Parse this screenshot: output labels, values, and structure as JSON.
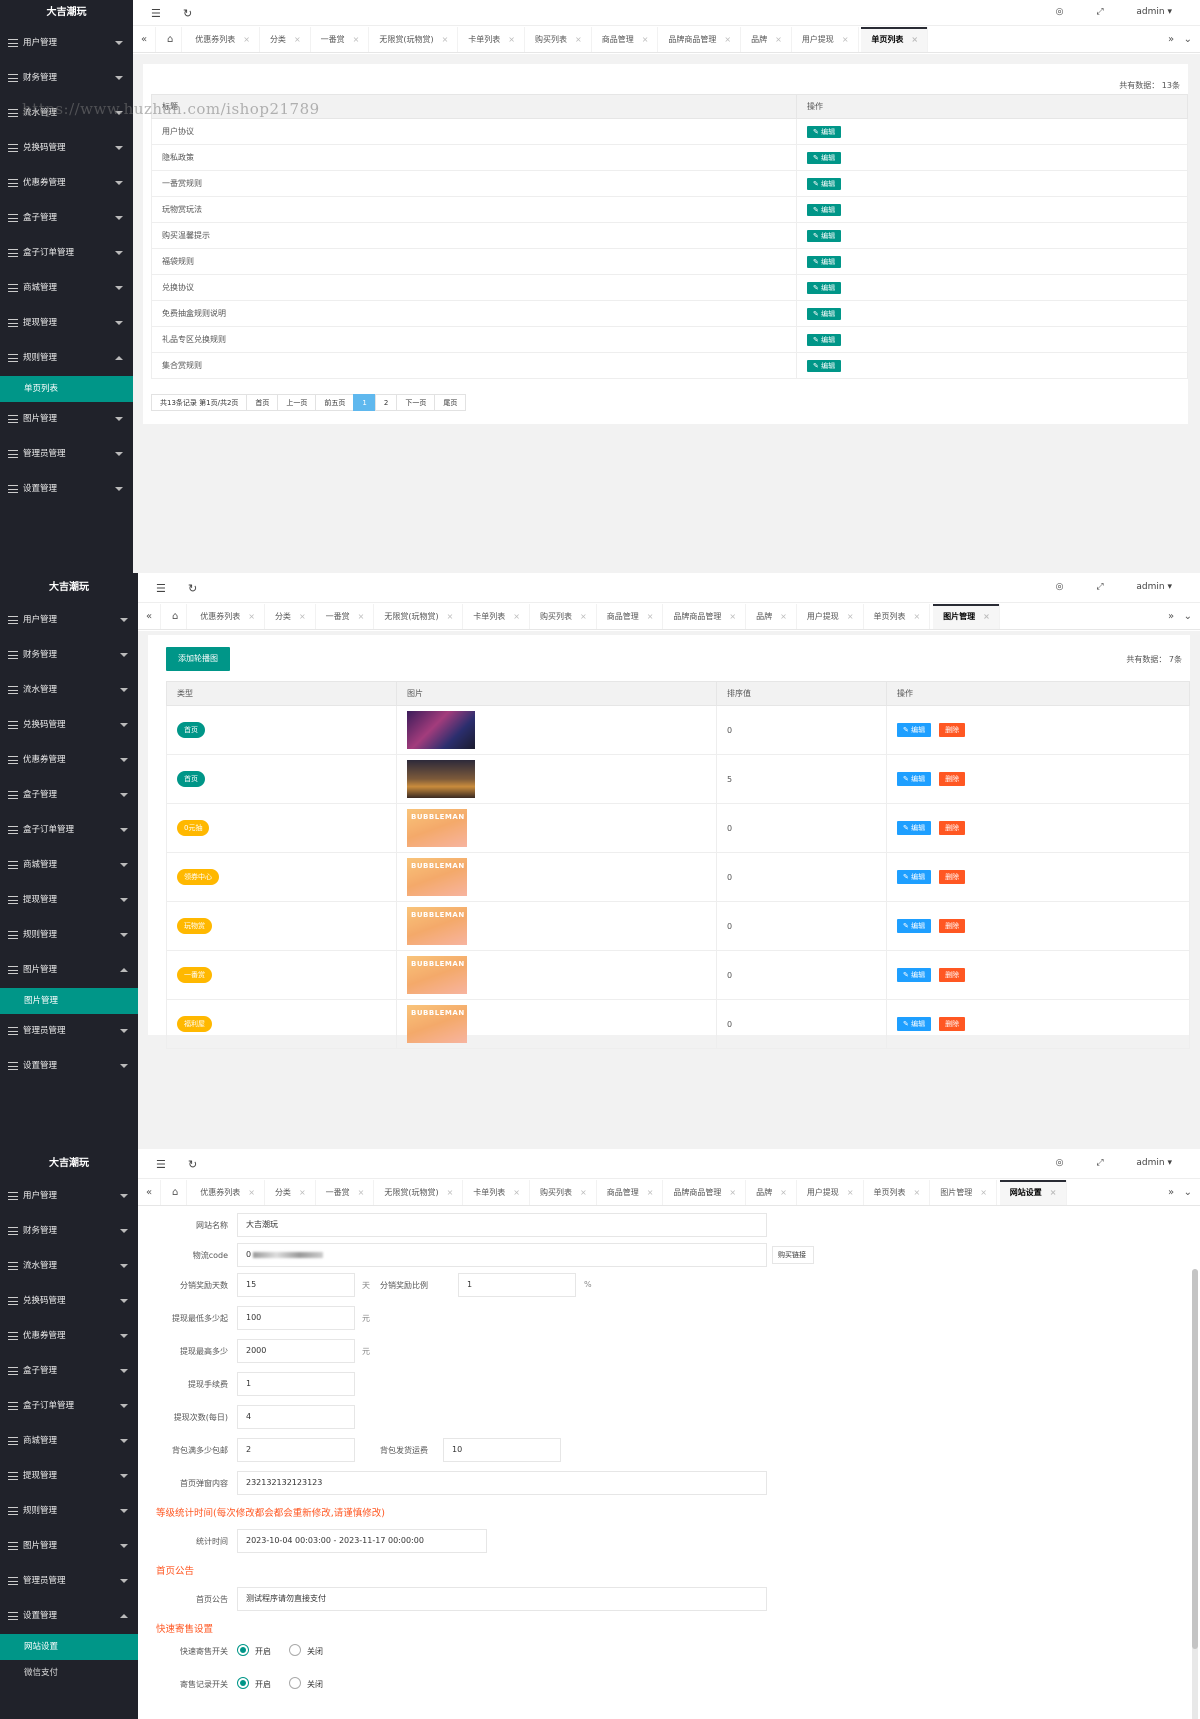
{
  "app": {
    "title": "大吉潮玩",
    "user": "admin"
  },
  "watermark": "https://www.huzhan.com/ishop21789",
  "panel1": {
    "menu": [
      "用户管理",
      "财务管理",
      "流水管理",
      "兑换码管理",
      "优惠券管理",
      "盒子管理",
      "盒子订单管理",
      "商城管理",
      "提现管理",
      "规则管理",
      "图片管理",
      "管理员管理",
      "设置管理"
    ],
    "submenu_active": "单页列表",
    "tabs": [
      "优惠券列表",
      "分类",
      "一番赏",
      "无限赏(玩物赏)",
      "卡单列表",
      "购买列表",
      "商品管理",
      "品牌商品管理",
      "品牌",
      "用户提现"
    ],
    "active_tab": "单页列表",
    "count": "共有数据：  13条",
    "table_headers": [
      "标题",
      "操作"
    ],
    "rows": [
      "用户协议",
      "隐私政策",
      "一番赏规则",
      "玩物赏玩法",
      "购买温馨提示",
      "福袋规则",
      "兑换协议",
      "免费抽盒规则说明",
      "礼品专区兑换规则",
      "集合赏规则"
    ],
    "edit_label": "✎ 编辑",
    "pager": [
      "共13条记录 第1页/共2页",
      "首页",
      "上一页",
      "前五页",
      "1",
      "2",
      "下一页",
      "尾页"
    ]
  },
  "panel2": {
    "menu_before": [
      "用户管理",
      "财务管理",
      "流水管理",
      "兑换码管理",
      "优惠券管理",
      "盒子管理",
      "盒子订单管理",
      "商城管理",
      "提现管理",
      "规则管理",
      "图片管理"
    ],
    "submenu_active": "图片管理",
    "menu_after": [
      "管理员管理",
      "设置管理"
    ],
    "tabs": [
      "优惠券列表",
      "分类",
      "一番赏",
      "无限赏(玩物赏)",
      "卡单列表",
      "购买列表",
      "商品管理",
      "品牌商品管理",
      "品牌",
      "用户提现",
      "单页列表"
    ],
    "active_tab": "图片管理",
    "add_button": "添加轮播图",
    "count": "共有数据：  7条",
    "table_headers": [
      "类型",
      "图片",
      "排序值",
      "操作"
    ],
    "rows": [
      {
        "type": "首页",
        "color": "#009688",
        "sort": "0",
        "img": "a"
      },
      {
        "type": "首页",
        "color": "#009688",
        "sort": "5",
        "img": "b"
      },
      {
        "type": "0元抽",
        "color": "#ffb800",
        "sort": "0",
        "img": "c"
      },
      {
        "type": "领券中心",
        "color": "#ffb800",
        "sort": "0",
        "img": "c"
      },
      {
        "type": "玩物赏",
        "color": "#ffb800",
        "sort": "0",
        "img": "c"
      },
      {
        "type": "一番赏",
        "color": "#ffb800",
        "sort": "0",
        "img": "c"
      },
      {
        "type": "福利屋",
        "color": "#ffb800",
        "sort": "0",
        "img": "c"
      }
    ],
    "banner_text": "BUBBLEMAN",
    "edit_label": "✎ 编辑",
    "delete_label": "删除"
  },
  "panel3": {
    "menu_before": [
      "用户管理",
      "财务管理",
      "流水管理",
      "兑换码管理",
      "优惠券管理",
      "盒子管理",
      "盒子订单管理",
      "商城管理",
      "提现管理",
      "规则管理",
      "图片管理",
      "管理员管理",
      "设置管理"
    ],
    "submenu": [
      "网站设置",
      "微信支付"
    ],
    "tabs": [
      "优惠券列表",
      "分类",
      "一番赏",
      "无限赏(玩物赏)",
      "卡单列表",
      "购买列表",
      "商品管理",
      "品牌商品管理",
      "品牌",
      "用户提现",
      "单页列表",
      "图片管理"
    ],
    "active_tab": "网站设置",
    "form": {
      "site_name_label": "网站名称",
      "site_name": "大吉潮玩",
      "logistics_label": "物流code",
      "logistics_value": "0",
      "logistics_button": "购买链接",
      "dist_days_label": "分销奖励天数",
      "dist_days": "15",
      "dist_days_unit": "天",
      "dist_ratio_label": "分销奖励比例",
      "dist_ratio": "1",
      "dist_ratio_unit": "%",
      "withdraw_min_label": "提现最低多少起",
      "withdraw_min": "100",
      "withdraw_min_unit": "元",
      "withdraw_max_label": "提现最高多少",
      "withdraw_max": "2000",
      "withdraw_max_unit": "元",
      "withdraw_fee_label": "提现手续费",
      "withdraw_fee": "1",
      "withdraw_times_label": "提现次数(每日)",
      "withdraw_times": "4",
      "free_ship_label": "背包满多少包邮",
      "free_ship": "2",
      "ship_fee_label": "背包发货运费",
      "ship_fee": "10",
      "popup_label": "首页弹窗内容",
      "popup": "232132132123123",
      "level_section": "等级统计时间(每次修改都会都会重新修改,请谨慎修改)",
      "stat_time_label": "统计时间",
      "stat_time": "2023-10-04 00:03:00 - 2023-11-17 00:00:00",
      "notice_section": "首页公告",
      "notice_label": "首页公告",
      "notice": "测试程序请勿直接支付",
      "consign_section": "快速寄售设置",
      "consign_switch_label": "快速寄售开关",
      "consign_record_label": "寄售记录开关",
      "on_label": "开启",
      "off_label": "关闭"
    }
  }
}
